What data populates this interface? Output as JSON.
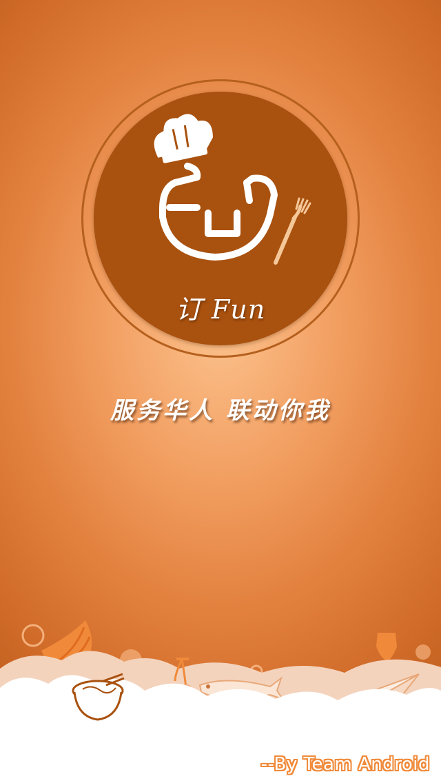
{
  "app": {
    "name": "订 Fun",
    "slogan": "服务华人 联动你我",
    "credit": "--By Team Android"
  },
  "logo": {
    "icons": [
      "chef-hat-icon",
      "smiley-face-logo",
      "fork-icon"
    ]
  },
  "footer": {
    "icons": [
      "banana-icon",
      "noodle-bowl-icon",
      "cherry-icon",
      "fish-icon",
      "paper-plane-icon",
      "wine-glass-icon"
    ]
  },
  "colors": {
    "background_center": "#fbc28d",
    "background_edge": "#c0601f",
    "logo_disc": "#a9510e",
    "logo_ring": "#b5601e",
    "credit_outline": "#f08a3a"
  }
}
